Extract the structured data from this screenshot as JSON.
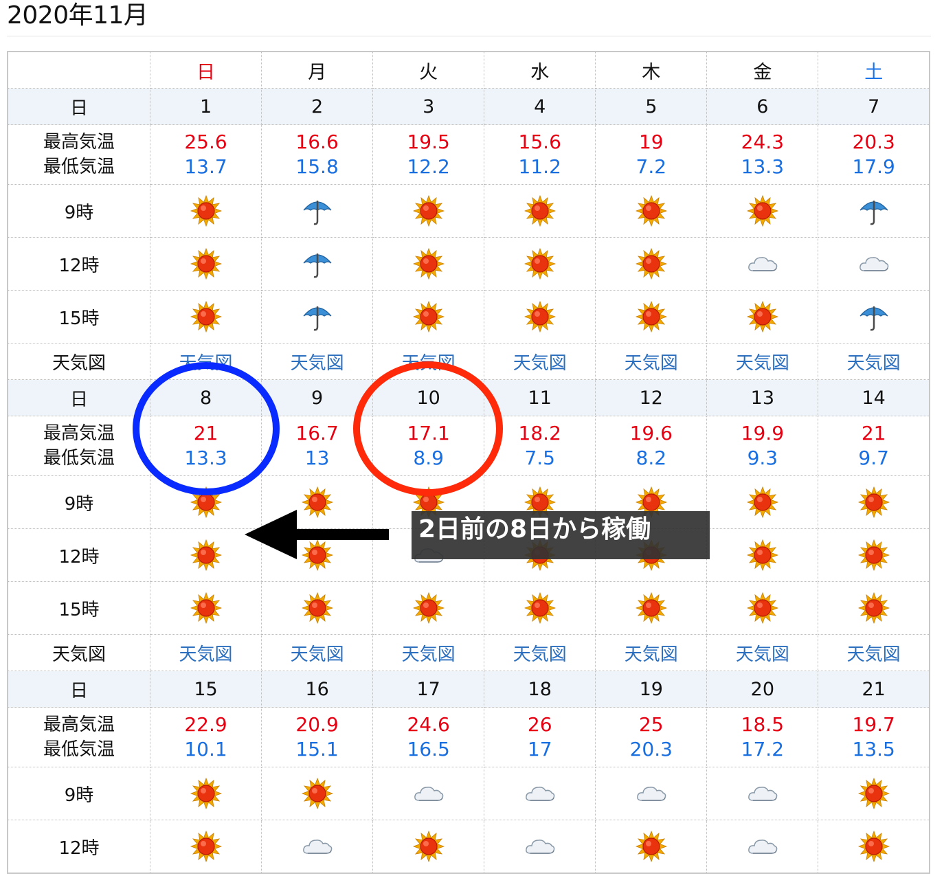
{
  "page": {
    "title": "2020年11月"
  },
  "calendar": {
    "weekdays": [
      {
        "label": "日",
        "kind": "sun"
      },
      {
        "label": "月",
        "kind": "wk"
      },
      {
        "label": "火",
        "kind": "wk"
      },
      {
        "label": "水",
        "kind": "wk"
      },
      {
        "label": "木",
        "kind": "wk"
      },
      {
        "label": "金",
        "kind": "wk"
      },
      {
        "label": "土",
        "kind": "sat"
      }
    ],
    "labels": {
      "day": "日",
      "max_temp": "最高気温",
      "min_temp": "最低気温",
      "h9": "9時",
      "h12": "12時",
      "h15": "15時",
      "weather_map": "天気図"
    },
    "colors": {
      "max": "#e60012",
      "min": "#1a6fe0",
      "link": "#2c6fbf",
      "sunday": "#e60012",
      "saturday": "#1a73e8"
    },
    "weeks": [
      {
        "days": [
          {
            "date": "1",
            "max": "25.6",
            "min": "13.7",
            "h9": "sun-icon",
            "h12": "sun-icon",
            "h15": "sun-icon",
            "map": "天気図"
          },
          {
            "date": "2",
            "max": "16.6",
            "min": "15.8",
            "h9": "umbrella-icon",
            "h12": "umbrella-icon",
            "h15": "umbrella-icon",
            "map": "天気図"
          },
          {
            "date": "3",
            "max": "19.5",
            "min": "12.2",
            "h9": "sun-icon",
            "h12": "sun-icon",
            "h15": "sun-icon",
            "map": "天気図"
          },
          {
            "date": "4",
            "max": "15.6",
            "min": "11.2",
            "h9": "sun-icon",
            "h12": "sun-icon",
            "h15": "sun-icon",
            "map": "天気図"
          },
          {
            "date": "5",
            "max": "19",
            "min": "7.2",
            "h9": "sun-icon",
            "h12": "sun-icon",
            "h15": "sun-icon",
            "map": "天気図"
          },
          {
            "date": "6",
            "max": "24.3",
            "min": "13.3",
            "h9": "sun-icon",
            "h12": "cloud-icon",
            "h15": "sun-icon",
            "map": "天気図"
          },
          {
            "date": "7",
            "max": "20.3",
            "min": "17.9",
            "h9": "umbrella-icon",
            "h12": "cloud-icon",
            "h15": "umbrella-icon",
            "map": "天気図"
          }
        ]
      },
      {
        "days": [
          {
            "date": "8",
            "max": "21",
            "min": "13.3",
            "h9": "sun-icon",
            "h12": "sun-icon",
            "h15": "sun-icon",
            "map": "天気図"
          },
          {
            "date": "9",
            "max": "16.7",
            "min": "13",
            "h9": "sun-icon",
            "h12": "sun-icon",
            "h15": "sun-icon",
            "map": "天気図"
          },
          {
            "date": "10",
            "max": "17.1",
            "min": "8.9",
            "h9": "sun-icon",
            "h12": "cloud-icon",
            "h15": "sun-icon",
            "map": "天気図"
          },
          {
            "date": "11",
            "max": "18.2",
            "min": "7.5",
            "h9": "sun-icon",
            "h12": "sun-icon",
            "h15": "sun-icon",
            "map": "天気図"
          },
          {
            "date": "12",
            "max": "19.6",
            "min": "8.2",
            "h9": "sun-icon",
            "h12": "sun-icon",
            "h15": "sun-icon",
            "map": "天気図"
          },
          {
            "date": "13",
            "max": "19.9",
            "min": "9.3",
            "h9": "sun-icon",
            "h12": "sun-icon",
            "h15": "sun-icon",
            "map": "天気図"
          },
          {
            "date": "14",
            "max": "21",
            "min": "9.7",
            "h9": "sun-icon",
            "h12": "sun-icon",
            "h15": "sun-icon",
            "map": "天気図"
          }
        ]
      },
      {
        "days": [
          {
            "date": "15",
            "max": "22.9",
            "min": "10.1",
            "h9": "sun-icon",
            "h12": "sun-icon"
          },
          {
            "date": "16",
            "max": "20.9",
            "min": "15.1",
            "h9": "sun-icon",
            "h12": "cloud-icon"
          },
          {
            "date": "17",
            "max": "24.6",
            "min": "16.5",
            "h9": "cloud-icon",
            "h12": "sun-icon"
          },
          {
            "date": "18",
            "max": "26",
            "min": "17",
            "h9": "cloud-icon",
            "h12": "cloud-icon"
          },
          {
            "date": "19",
            "max": "25",
            "min": "20.3",
            "h9": "cloud-icon",
            "h12": "sun-icon"
          },
          {
            "date": "20",
            "max": "18.5",
            "min": "17.2",
            "h9": "cloud-icon",
            "h12": "cloud-icon"
          },
          {
            "date": "21",
            "max": "19.7",
            "min": "13.5",
            "h9": "sun-icon",
            "h12": "sun-icon"
          }
        ]
      }
    ]
  },
  "annotation": {
    "note": "2日前の8日から稼働",
    "circle_colors": {
      "first": "#0a2bff",
      "second": "#ff2a0a"
    },
    "arrow_color": "#000000"
  }
}
